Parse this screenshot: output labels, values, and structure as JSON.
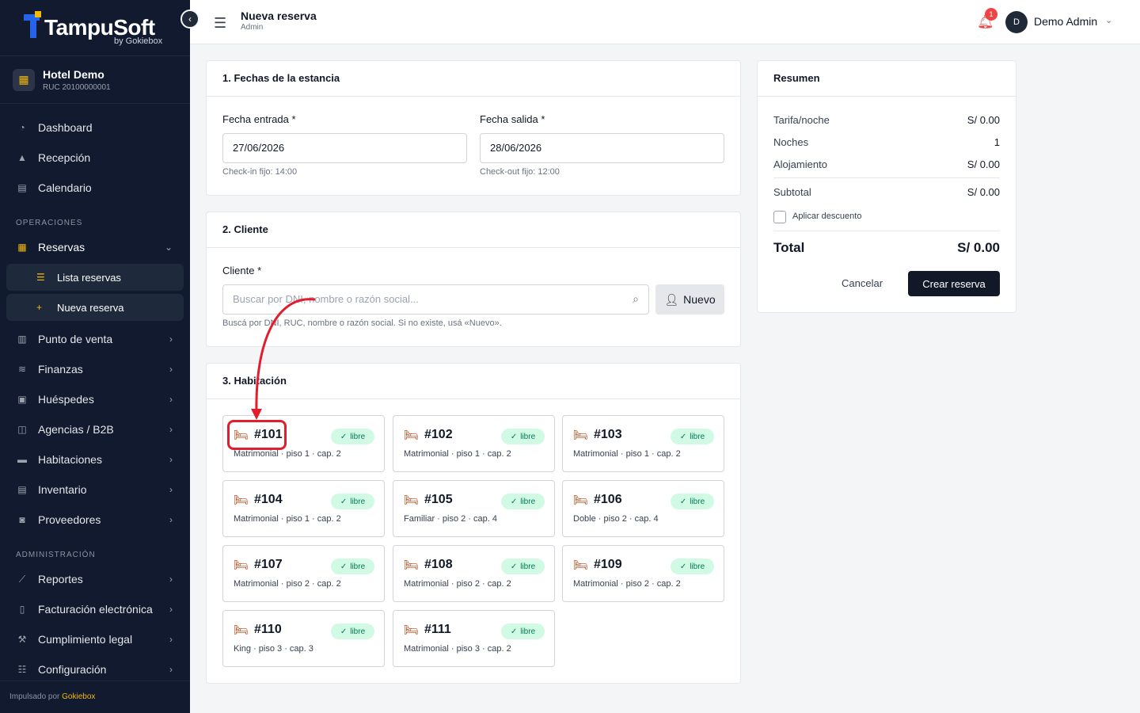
{
  "brand": {
    "name": "TampuSoft",
    "sub": "by Gokiebox"
  },
  "hotel": {
    "name": "Hotel Demo",
    "ruc": "RUC 20100000001"
  },
  "nav": {
    "dashboard": "Dashboard",
    "recepcion": "Recepción",
    "calendario": "Calendario",
    "section_ops": "OPERACIONES",
    "reservas": "Reservas",
    "lista_reservas": "Lista reservas",
    "nueva_reserva": "Nueva reserva",
    "punto_venta": "Punto de venta",
    "finanzas": "Finanzas",
    "huespedes": "Huéspedes",
    "agencias": "Agencias / B2B",
    "habitaciones": "Habitaciones",
    "inventario": "Inventario",
    "proveedores": "Proveedores",
    "section_admin": "ADMINISTRACIÓN",
    "reportes": "Reportes",
    "facturacion": "Facturación electrónica",
    "cumplimiento": "Cumplimiento legal",
    "configuracion": "Configuración"
  },
  "footer": {
    "prefix": "Impulsado por",
    "brand": "Gokiebox"
  },
  "header": {
    "title": "Nueva reserva",
    "subtitle": "Admin",
    "notifications": "1",
    "avatar": "D",
    "user": "Demo Admin"
  },
  "fechas": {
    "title": "1. Fechas de la estancia",
    "entrada_label": "Fecha entrada *",
    "entrada_value": "27/06/2026",
    "entrada_hint": "Check-in fijo: 14:00",
    "salida_label": "Fecha salida *",
    "salida_value": "28/06/2026",
    "salida_hint": "Check-out fijo: 12:00"
  },
  "cliente": {
    "title": "2. Cliente",
    "label": "Cliente *",
    "placeholder": "Buscar por DNI, nombre o razón social...",
    "new_button": "Nuevo",
    "hint": "Buscá por DNI, RUC, nombre o razón social. Si no existe, usá «Nuevo»."
  },
  "habitacion": {
    "title": "3. Habitación",
    "status": "libre",
    "rooms": [
      {
        "num": "#101",
        "desc": "Matrimonial · piso 1 · cap. 2"
      },
      {
        "num": "#102",
        "desc": "Matrimonial · piso 1 · cap. 2"
      },
      {
        "num": "#103",
        "desc": "Matrimonial · piso 1 · cap. 2"
      },
      {
        "num": "#104",
        "desc": "Matrimonial · piso 1 · cap. 2"
      },
      {
        "num": "#105",
        "desc": "Familiar · piso 2 · cap. 4"
      },
      {
        "num": "#106",
        "desc": "Doble · piso 2 · cap. 4"
      },
      {
        "num": "#107",
        "desc": "Matrimonial · piso 2 · cap. 2"
      },
      {
        "num": "#108",
        "desc": "Matrimonial · piso 2 · cap. 2"
      },
      {
        "num": "#109",
        "desc": "Matrimonial · piso 2 · cap. 2"
      },
      {
        "num": "#110",
        "desc": "King · piso 3 · cap. 3"
      },
      {
        "num": "#111",
        "desc": "Matrimonial · piso 3 · cap. 2"
      }
    ]
  },
  "resumen": {
    "title": "Resumen",
    "tarifa_label": "Tarifa/noche",
    "tarifa_value": "S/ 0.00",
    "noches_label": "Noches",
    "noches_value": "1",
    "aloj_label": "Alojamiento",
    "aloj_value": "S/ 0.00",
    "subtotal_label": "Subtotal",
    "subtotal_value": "S/ 0.00",
    "descuento_label": "Aplicar descuento",
    "total_label": "Total",
    "total_value": "S/ 0.00",
    "cancel": "Cancelar",
    "create": "Crear reserva"
  },
  "colors": {
    "sidebar": "#111a2e",
    "accent": "#f5b70a",
    "primary_btn": "#111827",
    "annotation": "#e11d2e",
    "free_badge": "#d1fae5"
  },
  "icons": [
    "dashboard-icon",
    "reception-icon",
    "calendar-icon",
    "reservations-icon",
    "list-icon",
    "plus-icon",
    "pos-icon",
    "finance-icon",
    "guests-icon",
    "agency-icon",
    "bed-icon",
    "inventory-icon",
    "truck-icon",
    "reports-icon",
    "invoice-icon",
    "legal-icon",
    "settings-icon",
    "bell-icon",
    "search-icon",
    "user-plus-icon",
    "check-icon",
    "menu-icon"
  ]
}
